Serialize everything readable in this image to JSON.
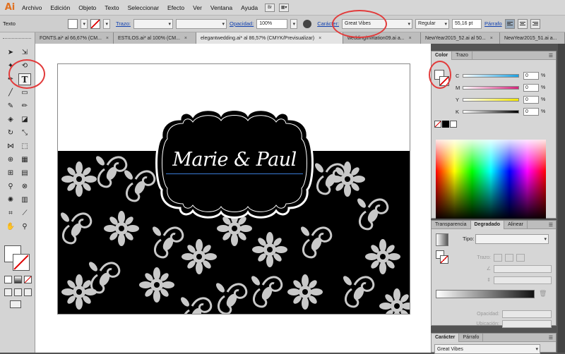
{
  "app": {
    "logo": "Ai"
  },
  "menu": [
    "Archivo",
    "Edición",
    "Objeto",
    "Texto",
    "Seleccionar",
    "Efecto",
    "Ver",
    "Ventana",
    "Ayuda"
  ],
  "menu_icons": [
    "Br"
  ],
  "control": {
    "mode_label": "Texto",
    "stroke_label": "Trazo:",
    "opacity_label": "Opacidad:",
    "opacity_value": "100%",
    "character_label": "Carácter:",
    "font_family": "Great Vibes",
    "font_style": "Regular",
    "font_size": "55,16 pt",
    "paragraph_label": "Párrafo"
  },
  "tabs": [
    {
      "label": "FONTS.ai* al 66,67% (CM...",
      "active": false
    },
    {
      "label": "ESTILOS.ai* al 100% (CM...",
      "active": false
    },
    {
      "label": "elegantwedding.ai* al 86,57% (CMYK/Previsualizar)",
      "active": true
    },
    {
      "label": "weddinginvitation09.ai a...",
      "active": false
    },
    {
      "label": "NewYear2015_52.ai al 50...",
      "active": false
    },
    {
      "label": "NewYear2015_51.ai a...",
      "active": false
    }
  ],
  "artwork": {
    "couple_name": "Marie & Paul"
  },
  "color_panel": {
    "tabs": [
      "Color",
      "Trazo"
    ],
    "channels": [
      {
        "letter": "C",
        "value": "0",
        "color": "#1ba1e2"
      },
      {
        "letter": "M",
        "value": "0",
        "color": "#d4237a"
      },
      {
        "letter": "Y",
        "value": "0",
        "color": "#f2e600"
      },
      {
        "letter": "K",
        "value": "0",
        "color": "#000000"
      }
    ],
    "pct": "%"
  },
  "gradient_panel": {
    "tabs": [
      "Transparencia",
      "Degradado",
      "Alinear"
    ],
    "type_label": "Tipo:",
    "stroke_label": "Trazo:",
    "opacity_label": "Opacidad:",
    "location_label": "Ubicación:"
  },
  "character_panel": {
    "tabs": [
      "Carácter",
      "Párrafo"
    ],
    "font_family": "Great Vibes"
  },
  "colors": {
    "accent": "#1040b0",
    "annotation": "#e23b3b"
  }
}
